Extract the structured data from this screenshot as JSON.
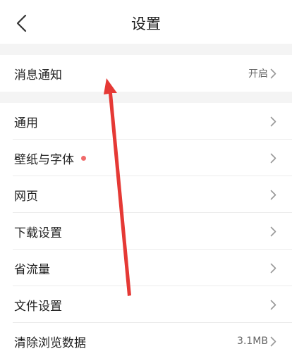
{
  "header": {
    "title": "设置",
    "back_icon": "chevron-left-icon"
  },
  "notification_row": {
    "label": "消息通知",
    "value": "开启"
  },
  "settings_rows": [
    {
      "key": "general",
      "label": "通用",
      "value": ""
    },
    {
      "key": "wallpaper-font",
      "label": "壁纸与字体",
      "value": "",
      "has_dot": true
    },
    {
      "key": "webpage",
      "label": "网页",
      "value": ""
    },
    {
      "key": "download",
      "label": "下载设置",
      "value": ""
    },
    {
      "key": "data-saver",
      "label": "省流量",
      "value": ""
    },
    {
      "key": "file",
      "label": "文件设置",
      "value": ""
    },
    {
      "key": "clear-data",
      "label": "清除浏览数据",
      "value": "3.1MB"
    }
  ],
  "colors": {
    "background": "#ffffff",
    "section_gap": "#f4f4f4",
    "badge_dot": "#f06a6a",
    "annotation_arrow": "#e53935"
  }
}
